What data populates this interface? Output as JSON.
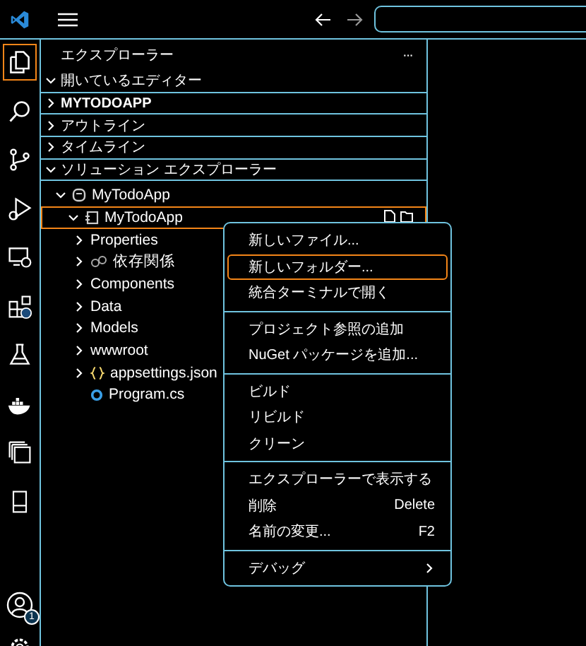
{
  "sidebar": {
    "title": "エクスプローラー",
    "more": "···",
    "sections": [
      {
        "label": "開いているエディター",
        "expanded": true,
        "bold": false
      },
      {
        "label": "MYTODOAPP",
        "expanded": false,
        "bold": true
      },
      {
        "label": "アウトライン",
        "expanded": false,
        "bold": false
      },
      {
        "label": "タイムライン",
        "expanded": false,
        "bold": false
      },
      {
        "label": "ソリューション エクスプローラー",
        "expanded": true,
        "bold": false
      }
    ],
    "tree": [
      {
        "label": "MyTodoApp",
        "kind": "solution",
        "expanded": true,
        "selected": false,
        "children": [
          {
            "label": "MyTodoApp",
            "kind": "project",
            "expanded": true,
            "selected": true,
            "children": [
              {
                "label": "Properties",
                "kind": "folder",
                "expanded": false,
                "selected": false
              },
              {
                "label": "依存関係",
                "kind": "dependencies",
                "expanded": false,
                "selected": false
              },
              {
                "label": "Components",
                "kind": "folder",
                "expanded": false,
                "selected": false
              },
              {
                "label": "Data",
                "kind": "folder",
                "expanded": false,
                "selected": false
              },
              {
                "label": "Models",
                "kind": "folder",
                "expanded": false,
                "selected": false
              },
              {
                "label": "wwwroot",
                "kind": "folder",
                "expanded": false,
                "selected": false
              },
              {
                "label": "appsettings.json",
                "kind": "json",
                "expanded": false,
                "selected": false
              },
              {
                "label": "Program.cs",
                "kind": "csharp",
                "selected": false
              }
            ]
          }
        ]
      }
    ]
  },
  "context_menu": {
    "groups": [
      [
        {
          "label": "新しいファイル...",
          "selected": false
        },
        {
          "label": "新しいフォルダー...",
          "selected": true
        },
        {
          "label": "統合ターミナルで開く",
          "selected": false
        }
      ],
      [
        {
          "label": "プロジェクト参照の追加",
          "selected": false
        },
        {
          "label": "NuGet パッケージを追加...",
          "selected": false
        }
      ],
      [
        {
          "label": "ビルド",
          "selected": false
        },
        {
          "label": "リビルド",
          "selected": false
        },
        {
          "label": "クリーン",
          "selected": false
        }
      ],
      [
        {
          "label": "エクスプローラーで表示する",
          "selected": false
        },
        {
          "label": "削除",
          "shortcut": "Delete",
          "selected": false
        },
        {
          "label": "名前の変更...",
          "shortcut": "F2",
          "selected": false
        }
      ],
      [
        {
          "label": "デバッグ",
          "submenu": true,
          "selected": false
        }
      ]
    ]
  },
  "activity_bar": {
    "account_badge": "1"
  }
}
